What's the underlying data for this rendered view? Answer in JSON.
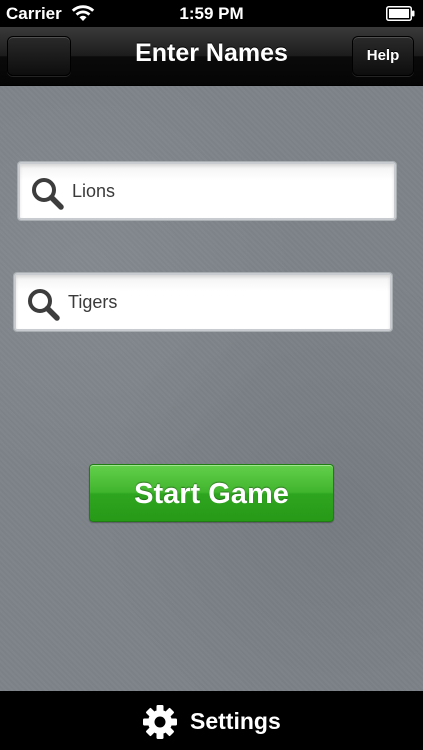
{
  "status_bar": {
    "carrier": "Carrier",
    "time": "1:59 PM"
  },
  "nav_bar": {
    "title": "Enter Names",
    "help_label": "Help"
  },
  "team_fields": {
    "team1_value": "Lions",
    "team2_value": "Tigers",
    "icon": "search-icon"
  },
  "start_button": {
    "label": "Start Game",
    "color": "#35ac24"
  },
  "bottom_bar": {
    "settings_label": "Settings",
    "icon": "gear-icon"
  },
  "colors": {
    "background": "#7d8389",
    "nav_bar": "#1c1c1c",
    "accent_green": "#35ac24"
  }
}
